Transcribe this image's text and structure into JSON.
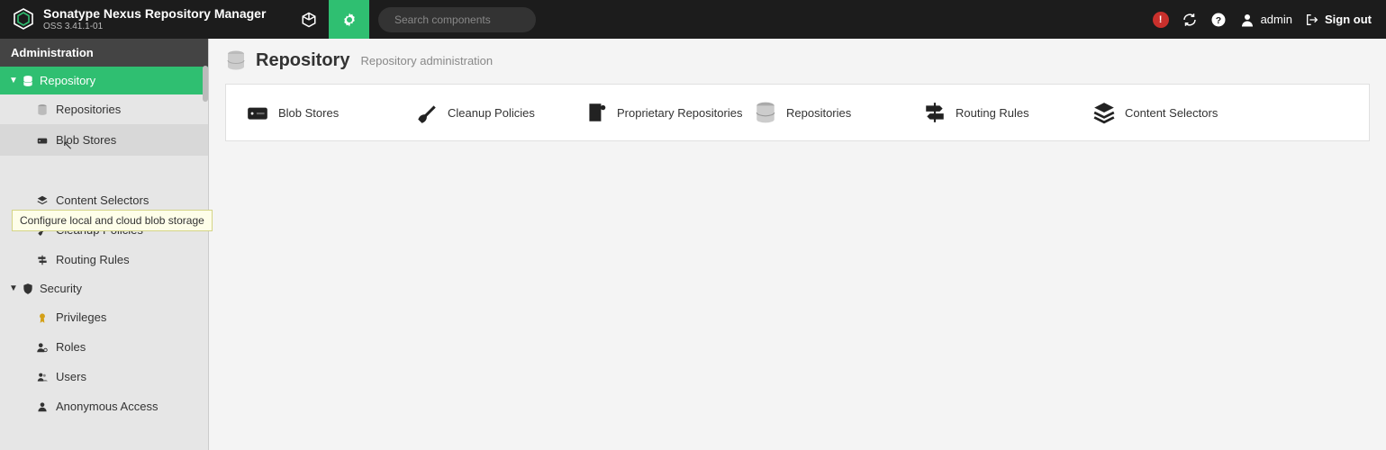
{
  "product": {
    "name": "Sonatype Nexus Repository Manager",
    "version": "OSS 3.41.1-01"
  },
  "search": {
    "placeholder": "Search components"
  },
  "header": {
    "username": "admin",
    "signout": "Sign out",
    "alert_count": "!"
  },
  "sidebar": {
    "header": "Administration",
    "repository": {
      "label": "Repository",
      "items": [
        {
          "label": "Repositories"
        },
        {
          "label": "Blob Stores"
        },
        {
          "label": "Content Selectors"
        },
        {
          "label": "Cleanup Policies"
        },
        {
          "label": "Routing Rules"
        }
      ]
    },
    "security": {
      "label": "Security",
      "items": [
        {
          "label": "Privileges"
        },
        {
          "label": "Roles"
        },
        {
          "label": "Users"
        },
        {
          "label": "Anonymous Access"
        }
      ]
    },
    "tooltip": "Configure local and cloud blob storage"
  },
  "page": {
    "title": "Repository",
    "subtitle": "Repository administration"
  },
  "cards": [
    {
      "label": "Blob Stores"
    },
    {
      "label": "Cleanup Policies"
    },
    {
      "label": "Proprietary Repositories"
    },
    {
      "label": "Repositories"
    },
    {
      "label": "Routing Rules"
    },
    {
      "label": "Content Selectors"
    }
  ]
}
